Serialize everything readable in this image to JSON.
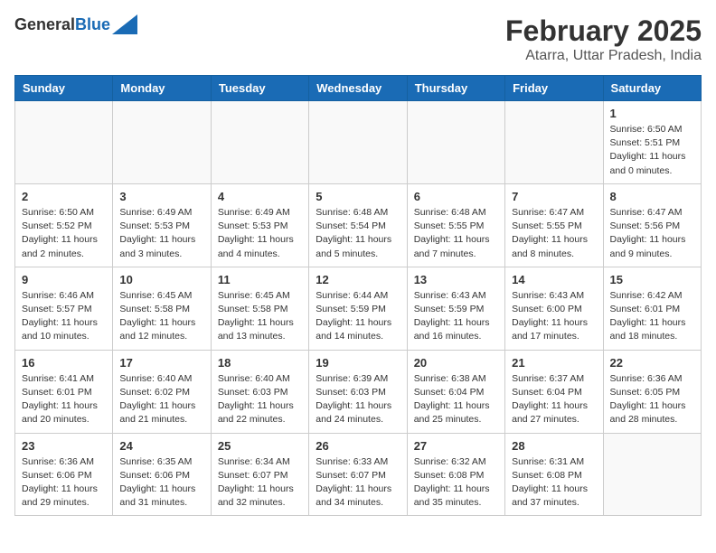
{
  "header": {
    "logo_general": "General",
    "logo_blue": "Blue",
    "main_title": "February 2025",
    "subtitle": "Atarra, Uttar Pradesh, India"
  },
  "weekdays": [
    "Sunday",
    "Monday",
    "Tuesday",
    "Wednesday",
    "Thursday",
    "Friday",
    "Saturday"
  ],
  "weeks": [
    [
      {
        "day": "",
        "info": ""
      },
      {
        "day": "",
        "info": ""
      },
      {
        "day": "",
        "info": ""
      },
      {
        "day": "",
        "info": ""
      },
      {
        "day": "",
        "info": ""
      },
      {
        "day": "",
        "info": ""
      },
      {
        "day": "1",
        "info": "Sunrise: 6:50 AM\nSunset: 5:51 PM\nDaylight: 11 hours\nand 0 minutes."
      }
    ],
    [
      {
        "day": "2",
        "info": "Sunrise: 6:50 AM\nSunset: 5:52 PM\nDaylight: 11 hours\nand 2 minutes."
      },
      {
        "day": "3",
        "info": "Sunrise: 6:49 AM\nSunset: 5:53 PM\nDaylight: 11 hours\nand 3 minutes."
      },
      {
        "day": "4",
        "info": "Sunrise: 6:49 AM\nSunset: 5:53 PM\nDaylight: 11 hours\nand 4 minutes."
      },
      {
        "day": "5",
        "info": "Sunrise: 6:48 AM\nSunset: 5:54 PM\nDaylight: 11 hours\nand 5 minutes."
      },
      {
        "day": "6",
        "info": "Sunrise: 6:48 AM\nSunset: 5:55 PM\nDaylight: 11 hours\nand 7 minutes."
      },
      {
        "day": "7",
        "info": "Sunrise: 6:47 AM\nSunset: 5:55 PM\nDaylight: 11 hours\nand 8 minutes."
      },
      {
        "day": "8",
        "info": "Sunrise: 6:47 AM\nSunset: 5:56 PM\nDaylight: 11 hours\nand 9 minutes."
      }
    ],
    [
      {
        "day": "9",
        "info": "Sunrise: 6:46 AM\nSunset: 5:57 PM\nDaylight: 11 hours\nand 10 minutes."
      },
      {
        "day": "10",
        "info": "Sunrise: 6:45 AM\nSunset: 5:58 PM\nDaylight: 11 hours\nand 12 minutes."
      },
      {
        "day": "11",
        "info": "Sunrise: 6:45 AM\nSunset: 5:58 PM\nDaylight: 11 hours\nand 13 minutes."
      },
      {
        "day": "12",
        "info": "Sunrise: 6:44 AM\nSunset: 5:59 PM\nDaylight: 11 hours\nand 14 minutes."
      },
      {
        "day": "13",
        "info": "Sunrise: 6:43 AM\nSunset: 5:59 PM\nDaylight: 11 hours\nand 16 minutes."
      },
      {
        "day": "14",
        "info": "Sunrise: 6:43 AM\nSunset: 6:00 PM\nDaylight: 11 hours\nand 17 minutes."
      },
      {
        "day": "15",
        "info": "Sunrise: 6:42 AM\nSunset: 6:01 PM\nDaylight: 11 hours\nand 18 minutes."
      }
    ],
    [
      {
        "day": "16",
        "info": "Sunrise: 6:41 AM\nSunset: 6:01 PM\nDaylight: 11 hours\nand 20 minutes."
      },
      {
        "day": "17",
        "info": "Sunrise: 6:40 AM\nSunset: 6:02 PM\nDaylight: 11 hours\nand 21 minutes."
      },
      {
        "day": "18",
        "info": "Sunrise: 6:40 AM\nSunset: 6:03 PM\nDaylight: 11 hours\nand 22 minutes."
      },
      {
        "day": "19",
        "info": "Sunrise: 6:39 AM\nSunset: 6:03 PM\nDaylight: 11 hours\nand 24 minutes."
      },
      {
        "day": "20",
        "info": "Sunrise: 6:38 AM\nSunset: 6:04 PM\nDaylight: 11 hours\nand 25 minutes."
      },
      {
        "day": "21",
        "info": "Sunrise: 6:37 AM\nSunset: 6:04 PM\nDaylight: 11 hours\nand 27 minutes."
      },
      {
        "day": "22",
        "info": "Sunrise: 6:36 AM\nSunset: 6:05 PM\nDaylight: 11 hours\nand 28 minutes."
      }
    ],
    [
      {
        "day": "23",
        "info": "Sunrise: 6:36 AM\nSunset: 6:06 PM\nDaylight: 11 hours\nand 29 minutes."
      },
      {
        "day": "24",
        "info": "Sunrise: 6:35 AM\nSunset: 6:06 PM\nDaylight: 11 hours\nand 31 minutes."
      },
      {
        "day": "25",
        "info": "Sunrise: 6:34 AM\nSunset: 6:07 PM\nDaylight: 11 hours\nand 32 minutes."
      },
      {
        "day": "26",
        "info": "Sunrise: 6:33 AM\nSunset: 6:07 PM\nDaylight: 11 hours\nand 34 minutes."
      },
      {
        "day": "27",
        "info": "Sunrise: 6:32 AM\nSunset: 6:08 PM\nDaylight: 11 hours\nand 35 minutes."
      },
      {
        "day": "28",
        "info": "Sunrise: 6:31 AM\nSunset: 6:08 PM\nDaylight: 11 hours\nand 37 minutes."
      },
      {
        "day": "",
        "info": ""
      }
    ]
  ]
}
